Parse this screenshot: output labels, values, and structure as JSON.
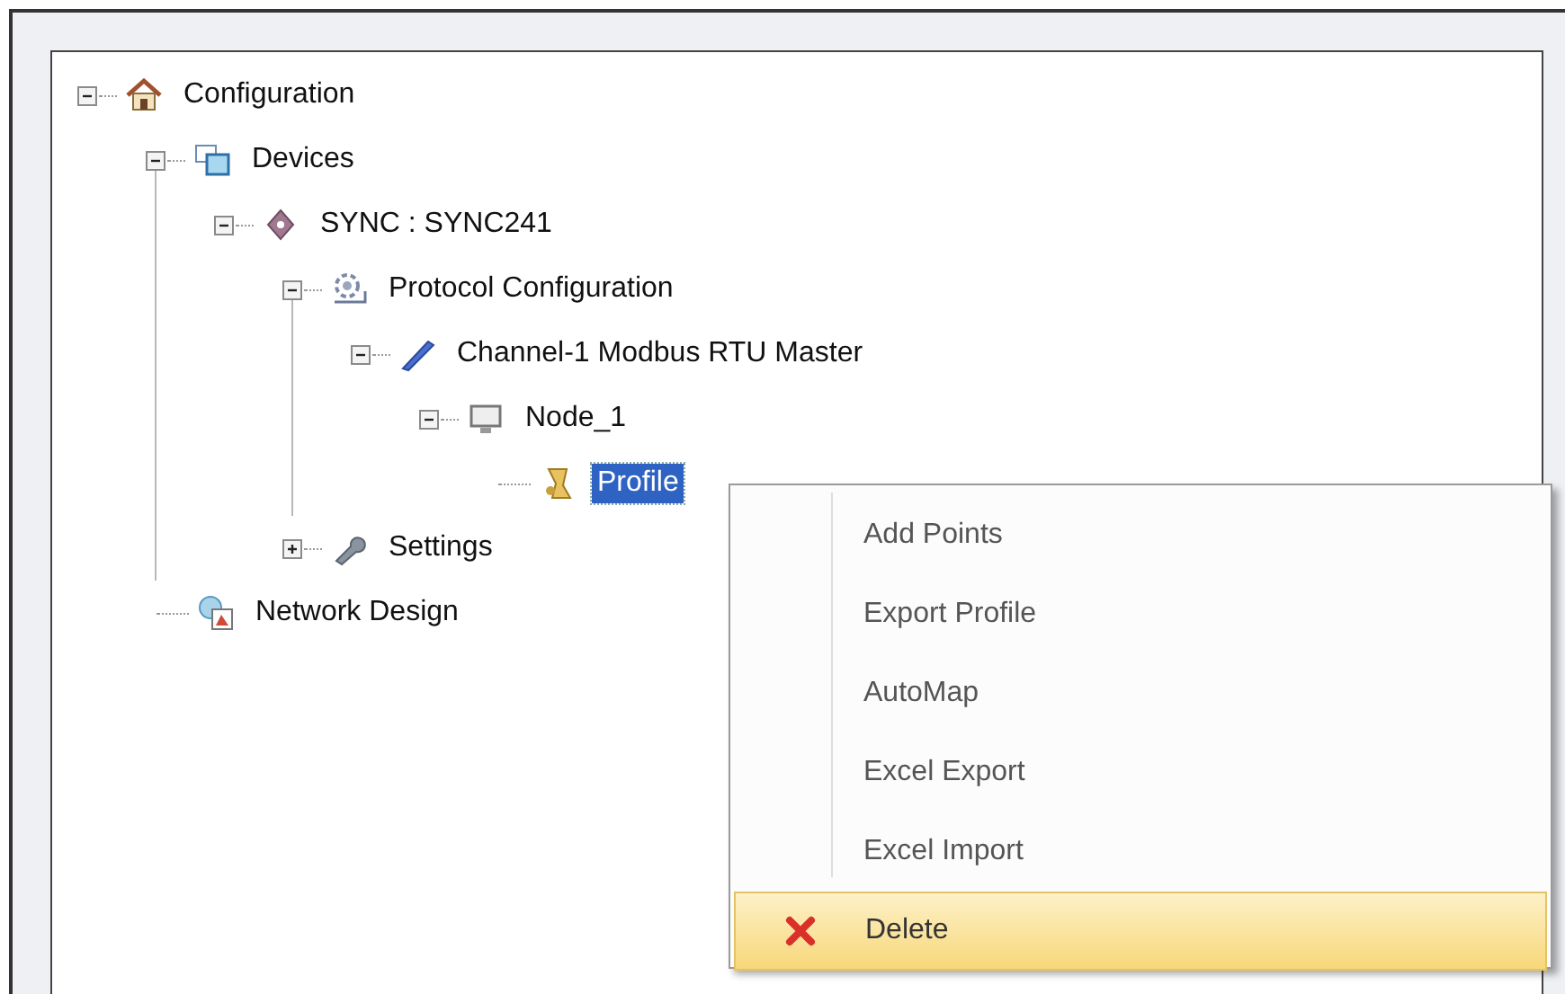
{
  "tree": [
    {
      "label": "Configuration",
      "kind": "home",
      "expanded": true,
      "selected": false,
      "children": [
        {
          "label": "Devices",
          "kind": "devices",
          "expanded": true,
          "selected": false,
          "children": [
            {
              "label": "SYNC : SYNC241",
              "kind": "device",
              "expanded": true,
              "selected": false,
              "children": [
                {
                  "label": "Protocol Configuration",
                  "kind": "protocol",
                  "expanded": true,
                  "selected": false,
                  "children": [
                    {
                      "label": "Channel-1 Modbus RTU Master",
                      "kind": "channel",
                      "expanded": true,
                      "selected": false,
                      "children": [
                        {
                          "label": "Node_1",
                          "kind": "node",
                          "expanded": true,
                          "selected": false,
                          "children": [
                            {
                              "label": "Profile",
                              "kind": "profile",
                              "selected": true
                            }
                          ]
                        }
                      ]
                    }
                  ]
                },
                {
                  "label": "Settings",
                  "kind": "settings",
                  "expanded": false,
                  "selected": false
                }
              ]
            }
          ]
        },
        {
          "label": "Network Design",
          "kind": "network",
          "selected": false
        }
      ]
    }
  ],
  "context_menu": {
    "items": [
      {
        "label": "Add Points",
        "kind": "plain",
        "selected": false
      },
      {
        "label": "Export Profile",
        "kind": "plain",
        "selected": false
      },
      {
        "label": "AutoMap",
        "kind": "plain",
        "selected": false
      },
      {
        "label": "Excel Export",
        "kind": "plain",
        "selected": false
      },
      {
        "label": "Excel Import",
        "kind": "plain",
        "selected": false
      },
      {
        "label": "Delete",
        "kind": "delete",
        "selected": true
      }
    ]
  }
}
